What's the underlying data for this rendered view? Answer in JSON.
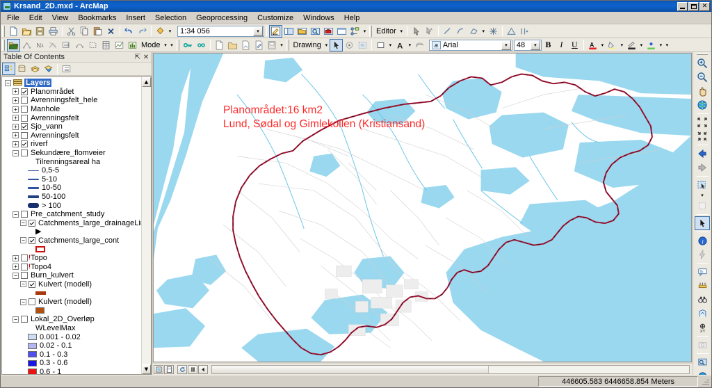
{
  "window": {
    "title": "Krsand_2D.mxd - ArcMap",
    "app_icon": "arcmap-globe-icon",
    "buttons": {
      "minimize": "_",
      "restore": "❐",
      "close": "×"
    }
  },
  "menubar": {
    "items": [
      "File",
      "Edit",
      "View",
      "Bookmarks",
      "Insert",
      "Selection",
      "Geoprocessing",
      "Customize",
      "Windows",
      "Help"
    ]
  },
  "standard_toolbar": {
    "scale_value": "1:34 056",
    "scale_placeholder": "1:34 056",
    "buttons": [
      {
        "name": "new-map-button",
        "icon": "new-document-icon"
      },
      {
        "name": "open-button",
        "icon": "open-folder-icon"
      },
      {
        "name": "save-button",
        "icon": "floppy-disk-icon"
      },
      {
        "name": "print-button",
        "icon": "printer-icon"
      },
      {
        "name": "cut-button",
        "icon": "scissors-icon"
      },
      {
        "name": "copy-button",
        "icon": "copy-icon"
      },
      {
        "name": "paste-button",
        "icon": "paste-icon"
      },
      {
        "name": "delete-button",
        "icon": "delete-x-icon"
      },
      {
        "name": "undo-button",
        "icon": "undo-arrow-icon"
      },
      {
        "name": "redo-button",
        "icon": "redo-arrow-icon"
      },
      {
        "name": "add-data-button",
        "icon": "add-data-plus-icon"
      }
    ],
    "trailing_buttons": [
      {
        "name": "editor-toolbar-toggle",
        "icon": "pencil-sketch-icon"
      },
      {
        "name": "table-of-contents-window-button",
        "icon": "toc-window-icon"
      },
      {
        "name": "catalog-window-button",
        "icon": "catalog-window-icon"
      },
      {
        "name": "search-window-button",
        "icon": "search-window-icon"
      },
      {
        "name": "arctoolbox-window-button",
        "icon": "toolbox-red-icon"
      },
      {
        "name": "python-window-button",
        "icon": "python-window-icon"
      },
      {
        "name": "model-builder-button",
        "icon": "modelbuilder-icon"
      }
    ]
  },
  "editor_toolbar": {
    "menu_label": "Editor",
    "buttons": [
      {
        "name": "edit-tool-button",
        "icon": "arrow-cursor-icon"
      },
      {
        "name": "edit-annotation-button",
        "icon": "annotation-cursor-icon"
      },
      {
        "name": "straight-segment-button",
        "icon": "line-segment-icon"
      },
      {
        "name": "end-point-arc-button",
        "icon": "arc-segment-icon"
      },
      {
        "name": "trace-button",
        "icon": "trace-icon"
      },
      {
        "name": "midpoint-button",
        "icon": "midpoint-snap-icon"
      },
      {
        "name": "construction-tools-button",
        "icon": "construction-icon"
      },
      {
        "name": "edit-vertices-button",
        "icon": "vertices-icon"
      }
    ]
  },
  "tools_toolbar_row2": {
    "mode_label": "Mode",
    "buttons": [
      {
        "name": "catalog-tree-button",
        "icon": "folder-open-yellow-icon"
      },
      {
        "name": "network-analyst-button",
        "icon": "network-icon"
      },
      {
        "name": "north-arrow-button",
        "icon": "north-arrow-icon"
      },
      {
        "name": "spatial-adjust-button",
        "icon": "spatial-adjust-icon"
      },
      {
        "name": "georeferencing-button",
        "icon": "georeference-icon"
      },
      {
        "name": "topology-button",
        "icon": "topology-icon"
      },
      {
        "name": "select-rect-button",
        "icon": "select-rectangle-icon"
      },
      {
        "name": "attribute-table-button",
        "icon": "table-icon"
      },
      {
        "name": "graph-button",
        "icon": "graph-icon"
      },
      {
        "name": "statistics-button",
        "icon": "statistics-icon"
      }
    ],
    "right_buttons": [
      {
        "name": "key-button",
        "icon": "key-icon"
      },
      {
        "name": "link-button",
        "icon": "chain-link-icon"
      },
      {
        "name": "new-file-button",
        "icon": "new-file-icon"
      },
      {
        "name": "open-file-button",
        "icon": "open-file-icon"
      },
      {
        "name": "save-layer-button",
        "icon": "save-layer-icon"
      },
      {
        "name": "edit-props-button",
        "icon": "edit-properties-icon"
      },
      {
        "name": "copy-layer-button",
        "icon": "copy-layer-icon"
      }
    ]
  },
  "drawing_toolbar": {
    "menu_label": "Drawing",
    "font_name": "Arial",
    "font_size": "48",
    "bold_label": "B",
    "italic_label": "I",
    "underline_label": "U",
    "font_color_label": "A",
    "buttons": [
      {
        "name": "select-elements-button",
        "icon": "arrow-cursor-icon"
      },
      {
        "name": "rotate-button",
        "icon": "rotate-icon"
      },
      {
        "name": "select-all-elements-button",
        "icon": "select-all-icon"
      },
      {
        "name": "new-rectangle-button",
        "icon": "rectangle-icon"
      },
      {
        "name": "new-text-button",
        "icon": "text-A-icon"
      },
      {
        "name": "draw-curve-button",
        "icon": "curve-icon"
      }
    ],
    "color_buttons": [
      {
        "name": "font-color-button",
        "icon": "font-color-icon",
        "color": "#e32222"
      },
      {
        "name": "fill-color-button",
        "icon": "fill-color-icon",
        "color": "#f2efa0"
      },
      {
        "name": "line-color-button",
        "icon": "line-color-icon",
        "color": "#2b2b2b"
      },
      {
        "name": "marker-color-button",
        "icon": "marker-color-icon",
        "color": "#2b5ed6"
      }
    ]
  },
  "toc": {
    "title": "Table Of Contents",
    "pin_icon": "pin-icon",
    "close_icon": "close-icon",
    "tool_buttons": [
      {
        "name": "list-by-drawing-order-button",
        "icon": "drawing-order-icon"
      },
      {
        "name": "list-by-source-button",
        "icon": "source-icon"
      },
      {
        "name": "list-by-visibility-button",
        "icon": "visibility-icon"
      },
      {
        "name": "list-by-selection-button",
        "icon": "selection-icon"
      },
      {
        "name": "options-button",
        "icon": "options-list-icon"
      }
    ],
    "root": {
      "label": "Layers",
      "icon": "layers-icon",
      "expander": "−",
      "selected": true
    },
    "items": [
      {
        "type": "layer",
        "indent": 1,
        "expander": "+",
        "checked": true,
        "label": "Planområdet"
      },
      {
        "type": "layer",
        "indent": 1,
        "expander": "+",
        "checked": false,
        "label": "Avrenningsfelt_hele"
      },
      {
        "type": "layer",
        "indent": 1,
        "expander": "+",
        "checked": false,
        "label": "Manhole"
      },
      {
        "type": "layer",
        "indent": 1,
        "expander": "+",
        "checked": false,
        "label": "Avrenningsfelt"
      },
      {
        "type": "layer",
        "indent": 1,
        "expander": "+",
        "checked": true,
        "label": "Sjo_vann"
      },
      {
        "type": "layer",
        "indent": 1,
        "expander": "+",
        "checked": false,
        "label": "Avrenningsfelt"
      },
      {
        "type": "layer",
        "indent": 1,
        "expander": "+",
        "checked": true,
        "label": "riverf"
      },
      {
        "type": "layer",
        "indent": 1,
        "expander": "−",
        "checked": false,
        "label": "Sekundære_flomveier"
      },
      {
        "type": "heading",
        "indent": 4,
        "label": "Tilrenningsareal ha"
      },
      {
        "type": "line-legend",
        "indent": 3,
        "label": "0,5-5",
        "width": 1,
        "color": "#2d52a0"
      },
      {
        "type": "line-legend",
        "indent": 3,
        "label": "5-10",
        "width": 2,
        "color": "#2d52a0"
      },
      {
        "type": "line-legend",
        "indent": 3,
        "label": "10-50",
        "width": 3,
        "color": "#2d52a0"
      },
      {
        "type": "line-legend",
        "indent": 3,
        "label": "50-100",
        "width": 4,
        "color": "#203f86"
      },
      {
        "type": "line-legend",
        "indent": 3,
        "label": "> 100",
        "width": 7,
        "color": "#16306e"
      },
      {
        "type": "layer",
        "indent": 1,
        "expander": "−",
        "checked": false,
        "label": "Pre_catchment_study"
      },
      {
        "type": "layer",
        "indent": 2,
        "expander": "−",
        "checked": true,
        "label": "Catchments_large_drainageLine"
      },
      {
        "type": "arrow-legend",
        "indent": 4,
        "label": ""
      },
      {
        "type": "layer",
        "indent": 2,
        "expander": "−",
        "checked": true,
        "label": "Catchments_large_cont"
      },
      {
        "type": "box-legend",
        "indent": 4,
        "label": "",
        "color": "#cc1111"
      },
      {
        "type": "layer",
        "indent": 1,
        "expander": "+",
        "checked": false,
        "warn": true,
        "label": "Topo"
      },
      {
        "type": "layer",
        "indent": 1,
        "expander": "+",
        "checked": false,
        "warn": true,
        "label": "Topo4"
      },
      {
        "type": "layer",
        "indent": 1,
        "expander": "−",
        "checked": false,
        "label": "Burn_kulvert"
      },
      {
        "type": "layer",
        "indent": 2,
        "expander": "−",
        "checked": true,
        "label": "Kulvert (modell)"
      },
      {
        "type": "swatch-legend",
        "indent": 4,
        "label": "",
        "color": "#a8390f",
        "shape": "bar"
      },
      {
        "type": "layer",
        "indent": 2,
        "expander": "−",
        "checked": false,
        "label": "Kulvert (modell)"
      },
      {
        "type": "swatch-legend",
        "indent": 4,
        "label": "",
        "color": "#b4500f",
        "shape": "square"
      },
      {
        "type": "layer",
        "indent": 1,
        "expander": "−",
        "checked": false,
        "label": "Lokal_2D_Overløp"
      },
      {
        "type": "heading",
        "indent": 4,
        "label": "WLevelMax"
      },
      {
        "type": "swatch-legend",
        "indent": 3,
        "label": "0.001 - 0.02",
        "color": "#cfdcf5",
        "shape": "square"
      },
      {
        "type": "swatch-legend",
        "indent": 3,
        "label": "0.02 - 0.1",
        "color": "#b3b6f0",
        "shape": "square"
      },
      {
        "type": "swatch-legend",
        "indent": 3,
        "label": "0.1 - 0.3",
        "color": "#5050ec",
        "shape": "square"
      },
      {
        "type": "swatch-legend",
        "indent": 3,
        "label": "0.3 - 0.6",
        "color": "#1a14e6",
        "shape": "square"
      },
      {
        "type": "swatch-legend",
        "indent": 3,
        "label": "0.6 - 1",
        "color": "#ee1111",
        "shape": "square"
      }
    ]
  },
  "map": {
    "annotation_line1": "Planområdet:16 km2",
    "annotation_line2": "Lund, Sødal og Gimlekollen (Kristiansand)",
    "annotation_color": "#ff2a2a",
    "water_color": "#9ad8ef",
    "land_color": "#ffffff",
    "boundary_color": "#b01030",
    "road_color": "#c9c9c9",
    "bottom_bar_buttons": [
      {
        "name": "data-view-button",
        "icon": "data-view-icon"
      },
      {
        "name": "layout-view-button",
        "icon": "layout-view-icon"
      },
      {
        "name": "refresh-view-button",
        "icon": "refresh-icon"
      },
      {
        "name": "pause-drawing-button",
        "icon": "pause-icon"
      },
      {
        "name": "scroll-left-button",
        "icon": "chevron-left-icon"
      }
    ]
  },
  "tools_panel": {
    "buttons": [
      {
        "name": "zoom-in-tool",
        "icon": "magnifier-plus-icon"
      },
      {
        "name": "zoom-out-tool",
        "icon": "magnifier-minus-icon"
      },
      {
        "name": "pan-tool",
        "icon": "hand-icon"
      },
      {
        "name": "full-extent-tool",
        "icon": "globe-icon"
      },
      {
        "name": "fixed-zoom-in-tool",
        "icon": "zoom-in-fixed-icon"
      },
      {
        "name": "fixed-zoom-out-tool",
        "icon": "zoom-out-fixed-icon"
      },
      {
        "name": "go-back-extent-tool",
        "icon": "arrow-left-blue-icon"
      },
      {
        "name": "go-forward-extent-tool",
        "icon": "arrow-right-gray-icon"
      },
      {
        "name": "select-features-tool",
        "icon": "select-features-icon"
      },
      {
        "name": "clear-selection-tool",
        "icon": "clear-selection-icon"
      },
      {
        "name": "select-elements-tool",
        "icon": "arrow-cursor-icon"
      },
      {
        "name": "identify-tool",
        "icon": "identify-info-icon"
      },
      {
        "name": "hyperlink-tool",
        "icon": "lightning-hyperlink-icon"
      },
      {
        "name": "html-popup-tool",
        "icon": "html-popup-icon"
      },
      {
        "name": "measure-tool",
        "icon": "measure-ruler-icon"
      },
      {
        "name": "find-tool",
        "icon": "binoculars-icon"
      },
      {
        "name": "find-route-tool",
        "icon": "find-route-icon"
      },
      {
        "name": "go-to-xy-tool",
        "icon": "go-to-xy-icon"
      },
      {
        "name": "time-slider-button",
        "icon": "time-slider-icon"
      },
      {
        "name": "create-viewer-window-button",
        "icon": "viewer-window-icon"
      },
      {
        "name": "arcglobe-button",
        "icon": "globe-earth-icon"
      },
      {
        "name": "toolbar-overflow-button",
        "icon": "overflow-chevron-icon"
      }
    ]
  },
  "status": {
    "coordinates": "446605.583  6446658.854 Meters"
  }
}
